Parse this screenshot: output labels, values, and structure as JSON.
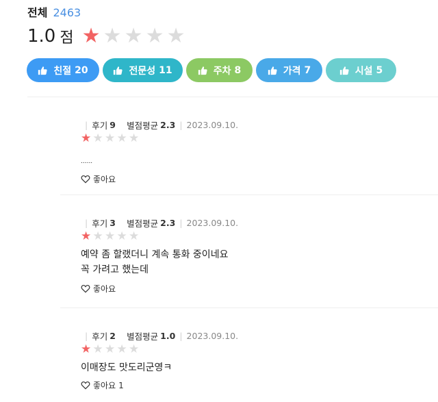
{
  "summary": {
    "total_label": "전체",
    "total_count": "2463",
    "score": "1.0",
    "score_unit": "점",
    "rating": 1,
    "max_rating": 5
  },
  "tags": [
    {
      "label": "친절",
      "count": "20",
      "color": "#3d9bf4",
      "icon": "thumbs-up-icon"
    },
    {
      "label": "전문성",
      "count": "11",
      "color": "#2fb6c9",
      "icon": "thumbs-up-icon"
    },
    {
      "label": "주차",
      "count": "8",
      "color": "#8cc963",
      "icon": "thumbs-up-icon"
    },
    {
      "label": "가격",
      "count": "7",
      "color": "#49a9e8",
      "icon": "thumbs-up-icon"
    },
    {
      "label": "시설",
      "count": "5",
      "color": "#6ccfcf",
      "icon": "thumbs-up-icon"
    }
  ],
  "reviews": [
    {
      "name": "",
      "review_label": "후기",
      "review_count": "9",
      "avg_label": "별점평균",
      "avg_value": "2.3",
      "date": "2023.09.10.",
      "rating": 1,
      "text": "......",
      "like_label": "좋아요",
      "like_count": ""
    },
    {
      "name": "",
      "review_label": "후기",
      "review_count": "3",
      "avg_label": "별점평균",
      "avg_value": "2.3",
      "date": "2023.09.10.",
      "rating": 1,
      "text": "예약 좀 할랬더니 계속 통화 중이네요\n꼭 가려고 했는데",
      "like_label": "좋아요",
      "like_count": ""
    },
    {
      "name": "",
      "review_label": "후기",
      "review_count": "2",
      "avg_label": "별점평균",
      "avg_value": "1.0",
      "date": "2023.09.10.",
      "rating": 1,
      "text": "이매장도 맛도리군영ㅋ",
      "like_label": "좋아요",
      "like_count": "1"
    }
  ],
  "colors": {
    "star_on": "#f26363",
    "star_off": "#dcdcdc",
    "accent": "#4a90e2"
  }
}
